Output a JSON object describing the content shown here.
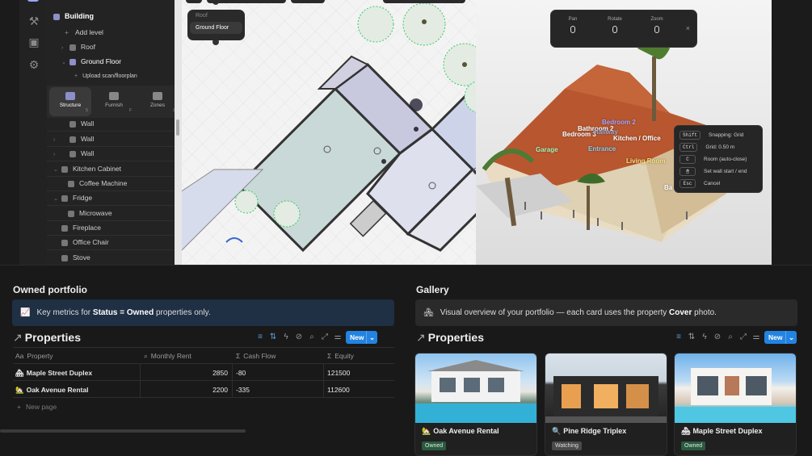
{
  "editor": {
    "tree": {
      "root": "Building",
      "add_level": "Add level",
      "levels": [
        "Roof",
        "Ground Floor"
      ],
      "upload": "Upload scan/floorplan",
      "tabs": [
        {
          "label": "Structure",
          "key": "S"
        },
        {
          "label": "Furnish",
          "key": "F"
        },
        {
          "label": "Zones",
          "key": "Z"
        }
      ],
      "items": [
        "Wall",
        "Wall",
        "Wall",
        "Kitchen Cabinet",
        "Coffee Machine",
        "Fridge",
        "Microwave",
        "Fireplace",
        "Office Chair",
        "Stove"
      ]
    },
    "level_popup": {
      "items": [
        "Roof",
        "Ground Floor"
      ]
    },
    "controls": {
      "pan": "Pan",
      "rotate": "Rotate",
      "zoom": "Zoom",
      "close": "×"
    },
    "shortcuts": [
      {
        "key": "Shift",
        "label": "Snapping: Grid"
      },
      {
        "key": "Ctrl",
        "label": "Grid: 0.50 m"
      },
      {
        "key": "C",
        "label": "Room (auto-close)"
      },
      {
        "key": "🖱",
        "label": "Set wall start / end"
      },
      {
        "key": "Esc",
        "label": "Cancel"
      }
    ],
    "rooms": [
      "Bedroom 2",
      "Bathroom 2",
      "Bedroom 3",
      "Hallway",
      "Kitchen / Office",
      "Garage",
      "Entrance",
      "Living Room",
      "Ba"
    ]
  },
  "portfolio": {
    "title": "Owned portfolio",
    "callout_pre": "Key metrics for ",
    "callout_bold": "Status = Owned",
    "callout_post": " properties only.",
    "view_title": "Properties",
    "new_label": "New",
    "columns": [
      "Property",
      "Monthly Rent",
      "Cash Flow",
      "Equity"
    ],
    "rows": [
      {
        "name": "Maple Street Duplex",
        "rent": "2850",
        "cash": "-80",
        "equity": "121500"
      },
      {
        "name": "Oak Avenue Rental",
        "rent": "2200",
        "cash": "-335",
        "equity": "112600"
      }
    ],
    "new_page": "New page"
  },
  "gallery": {
    "title": "Gallery",
    "callout_pre": "Visual overview of your portfolio — each card uses the property ",
    "callout_bold": "Cover",
    "callout_post": " photo.",
    "view_title": "Properties",
    "new_label": "New",
    "cards": [
      {
        "name": "Oak Avenue Rental",
        "status": "Owned",
        "status_color": "#2b593f"
      },
      {
        "name": "Pine Ridge Triplex",
        "status": "Watching",
        "status_color": "#4a4a4a"
      },
      {
        "name": "Maple Street Duplex",
        "status": "Owned",
        "status_color": "#2b593f"
      }
    ]
  }
}
